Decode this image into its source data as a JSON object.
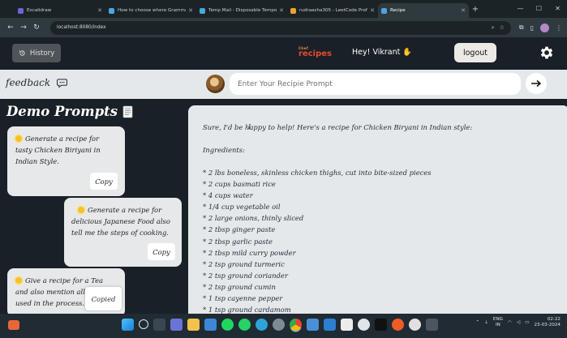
{
  "browser": {
    "tabs": [
      {
        "label": "Excalidraw",
        "active": false,
        "color": "#6965db"
      },
      {
        "label": "How to choose where Grammar",
        "active": false,
        "color": "#4aa7e0"
      },
      {
        "label": "Temp Mail - Disposable Tempo",
        "active": false,
        "color": "#4aa7e0"
      },
      {
        "label": "rudraasha305 - LeetCode Profi",
        "active": false,
        "color": "#f0a030"
      },
      {
        "label": "Recipe",
        "active": true,
        "color": "#4aa7e0"
      }
    ],
    "url": "localhost:8080/index"
  },
  "header": {
    "history_label": "History",
    "brand_small": "Chef",
    "brand": "recipes",
    "greeting": "Hey! Vikrant",
    "logout_label": "logout"
  },
  "prompt_bar": {
    "feedback_label": "feedback",
    "placeholder": "Enter Your Recipie Prompt"
  },
  "demo": {
    "title": "Demo Prompts",
    "prompts": [
      {
        "text": "Generate a recipe for tasty Chicken Biriyani in Indian Style.",
        "button": "Copy"
      },
      {
        "text": "Generate a recipe for delicious Japanese Food also tell me the steps of cooking.",
        "button": "Copy"
      },
      {
        "text": "Give a recipe for a Tea and also mention all the in",
        "text_tail": "used in the process.",
        "button": "Copied"
      }
    ]
  },
  "response": {
    "intro": "Sure, I'd be happy to help! Here's a recipe for Chicken Biryani in Indian style:",
    "ingredients_heading": "Ingredients:",
    "ingredients": [
      "* 2 lbs boneless, skinless chicken thighs, cut into bite-sized pieces",
      "* 2 cups basmati rice",
      "* 4 cups water",
      "* 1/4 cup vegetable oil",
      "* 2 large onions, thinly sliced",
      "* 2 tbsp ginger paste",
      "* 2 tbsp garlic paste",
      "* 2 tbsp mild curry powder",
      "* 2 tsp ground turmeric",
      "* 2 tsp ground coriander",
      "* 2 tsp ground cumin",
      "* 1 tsp cayenne pepper",
      "* 1 tsp ground cardamom"
    ]
  },
  "taskbar": {
    "lang_top": "ENG",
    "lang_bottom": "IN",
    "time": "02:22",
    "date": "23-03-2024"
  }
}
